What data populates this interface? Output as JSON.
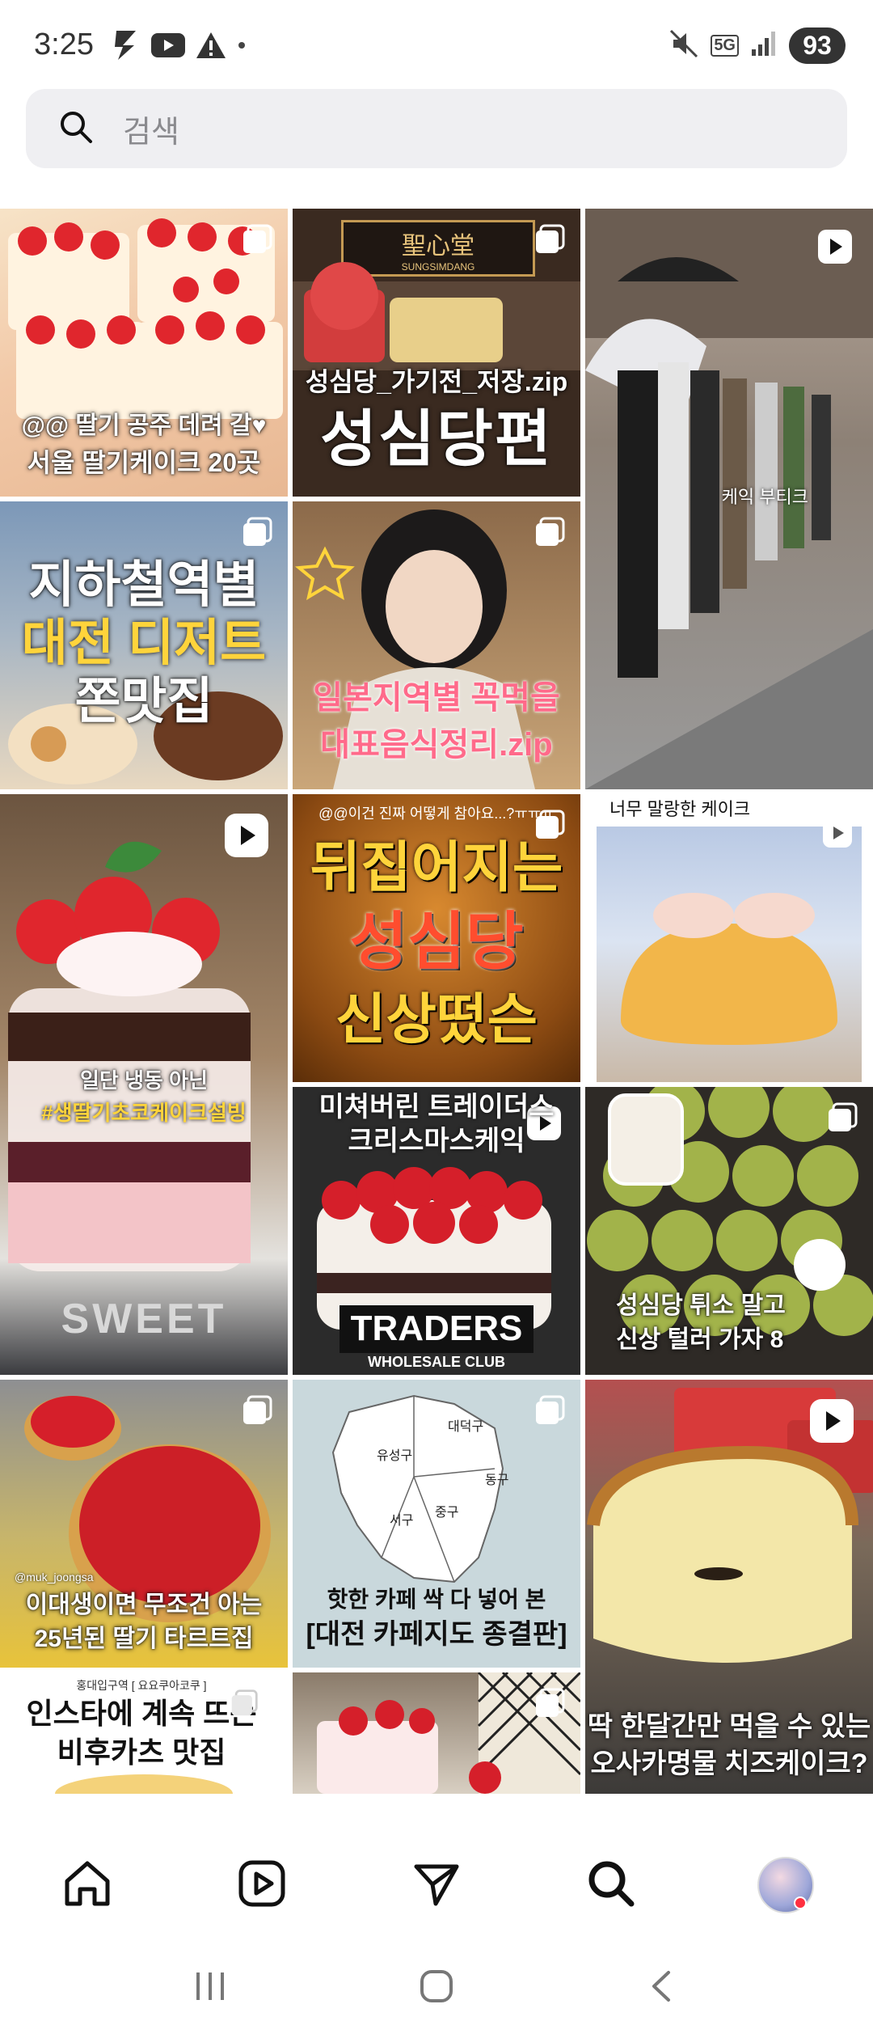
{
  "status_bar": {
    "time": "3:25",
    "network": "5G",
    "battery": "93",
    "icons": [
      "bolt-icon",
      "youtube-icon",
      "warning-icon",
      "dot-icon",
      "mute-icon",
      "signal-icon"
    ]
  },
  "search": {
    "placeholder": "검색",
    "icon": "search-icon"
  },
  "tiles": [
    {
      "id": "t1",
      "line1": "@@ 딸기 공주 데려 갈♥",
      "line2": "서울 딸기케이크 20곳",
      "type": "carousel"
    },
    {
      "id": "t2",
      "line1": "성심당_가기전_저장.zip",
      "line2": "성심당편",
      "sign": "聖心堂",
      "sign_sub": "SUNGSIMDANG",
      "type": "carousel"
    },
    {
      "id": "t3",
      "line1": "케익 부티크",
      "type": "reel"
    },
    {
      "id": "t4",
      "line1": "지하철역별",
      "line2": "대전 디저트",
      "line3": "쫀맛집",
      "type": "carousel"
    },
    {
      "id": "t5",
      "line1": "일본지역별 꼭먹을",
      "line2": "대표음식정리.zip",
      "type": "carousel"
    },
    {
      "id": "t6",
      "line1": "일단 냉동 아닌",
      "line2": "#생딸기초코케이크설빙",
      "brand": "SWEET",
      "type": "reel"
    },
    {
      "id": "t7",
      "top": "@@이건 진짜 어떻게 참아요...?ㅠㅠㅠ",
      "line1": "뒤집어지는",
      "line2": "성심당",
      "line3": "신상떴슨",
      "type": "carousel"
    },
    {
      "id": "t8",
      "line1": "너무 말랑한 케이크",
      "type": "reel"
    },
    {
      "id": "t9",
      "line1": "미쳐버린 트레이더스",
      "line2": "크리스마스케익",
      "brand": "TRADERS",
      "brand_sub": "WHOLESALE CLUB",
      "type": "reel"
    },
    {
      "id": "t10",
      "line1": "성심당 튀소 말고",
      "line2": "신상 털러 가자 8",
      "type": "carousel"
    },
    {
      "id": "t11",
      "handle": "@muk_joongsa",
      "line1": "이대생이면 무조건 아는",
      "line2": "25년된 딸기 타르트집",
      "type": "carousel"
    },
    {
      "id": "t12",
      "line1": "핫한 카페 싹 다 넣어 본",
      "line2": "[대전 카페지도 종결판]",
      "districts": [
        "유성구",
        "대덕구",
        "동구",
        "중구",
        "서구"
      ],
      "type": "carousel"
    },
    {
      "id": "t13",
      "line1": "딱 한달간만 먹을 수 있는",
      "line2": "오사카명물 치즈케이크?",
      "type": "reel"
    },
    {
      "id": "t14",
      "top": "홍대입구역 [ 요요쿠아코쿠 ]",
      "line1": "인스타에 계속 뜨는",
      "line2": "비후카츠 맛집",
      "type": "carousel"
    },
    {
      "id": "t15",
      "type": "carousel"
    }
  ],
  "bottom_nav": {
    "items": [
      "home-icon",
      "reels-icon",
      "messages-icon",
      "search-icon",
      "profile-avatar"
    ],
    "active": "search-icon"
  },
  "system_nav": [
    "recents-button",
    "home-button",
    "back-button"
  ],
  "colors": {
    "search_bg": "#efeff2",
    "placeholder": "#8a8a8e",
    "notification_dot": "#ff3040",
    "highlight_yellow": "#ffd43b",
    "highlight_pink": "#ff6a8a"
  }
}
